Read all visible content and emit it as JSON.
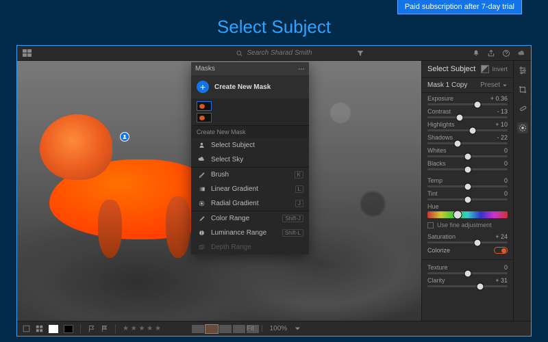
{
  "trial_badge": "Paid subscription after 7-day trial",
  "page_title": "Select Subject",
  "search": {
    "placeholder": "Search Sharad Smith"
  },
  "masks_popover": {
    "title": "Masks",
    "create_label": "Create New Mask",
    "section_label": "Create New Mask",
    "items": [
      {
        "label": "Select Subject",
        "kbd": ""
      },
      {
        "label": "Select Sky",
        "kbd": ""
      }
    ],
    "tools": [
      {
        "label": "Brush",
        "kbd": "K"
      },
      {
        "label": "Linear Gradient",
        "kbd": "L"
      },
      {
        "label": "Radial Gradient",
        "kbd": "J"
      }
    ],
    "ranges": [
      {
        "label": "Color Range",
        "kbd": "Shift-J"
      },
      {
        "label": "Luminance Range",
        "kbd": "Shift-L"
      },
      {
        "label": "Depth Range",
        "kbd": "",
        "disabled": true
      }
    ]
  },
  "panel": {
    "title": "Select Subject",
    "invert_label": "Invert",
    "mask_name": "Mask 1 Copy",
    "preset_label": "Preset",
    "sliders": [
      {
        "label": "Exposure",
        "value": "+ 0.36",
        "pos": 62
      },
      {
        "label": "Contrast",
        "value": "- 13",
        "pos": 40
      },
      {
        "label": "Highlights",
        "value": "+ 10",
        "pos": 56
      },
      {
        "label": "Shadows",
        "value": "- 22",
        "pos": 38
      },
      {
        "label": "Whites",
        "value": "0",
        "pos": 50
      },
      {
        "label": "Blacks",
        "value": "0",
        "pos": 50
      }
    ],
    "temp": {
      "label": "Temp",
      "value": "0",
      "pos": 50
    },
    "tint": {
      "label": "Tint",
      "value": "0",
      "pos": 50
    },
    "hue": {
      "label": "Hue",
      "pos": 38
    },
    "fine_adj_label": "Use fine adjustment",
    "saturation": {
      "label": "Saturation",
      "value": "+ 24",
      "pos": 62
    },
    "colorize_label": "Colorize",
    "bottom_sliders": [
      {
        "label": "Texture",
        "value": "0",
        "pos": 50
      },
      {
        "label": "Clarity",
        "value": "+ 31",
        "pos": 66
      }
    ]
  },
  "bottombar": {
    "fit_label": "Fit",
    "zoom_label": "100%"
  },
  "colors": {
    "accent": "#1473e6",
    "subject": "#e85a1e"
  }
}
